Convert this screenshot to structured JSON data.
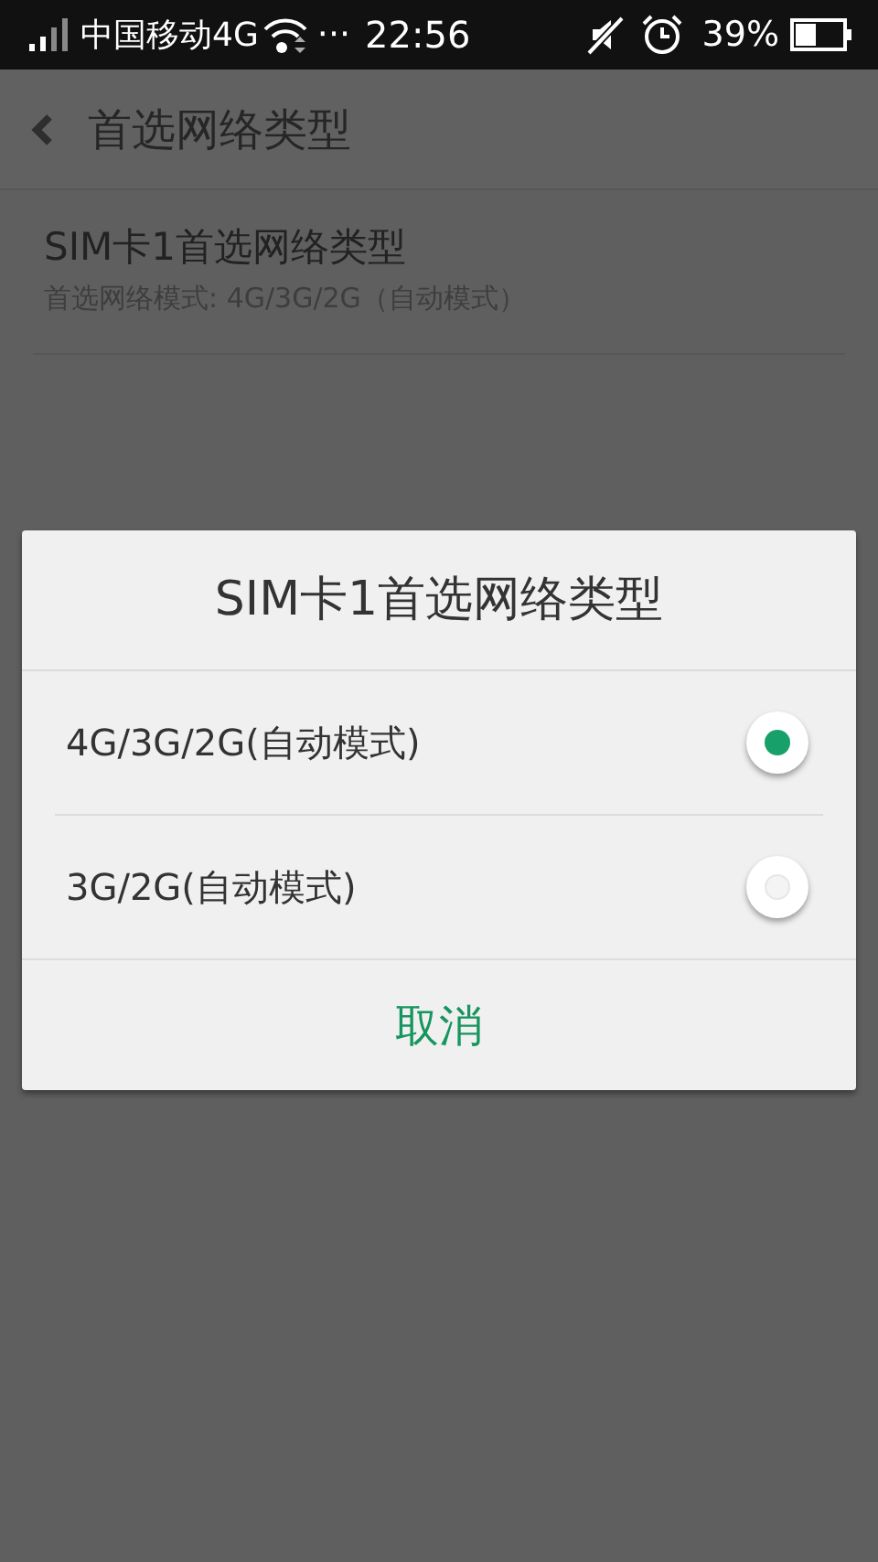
{
  "status_bar": {
    "carrier": "中国移动4G",
    "more": "···",
    "time": "22:56",
    "battery": "39%"
  },
  "header": {
    "title": "首选网络类型"
  },
  "settings": [
    {
      "title": "SIM卡1首选网络类型",
      "subtitle": "首选网络模式: 4G/3G/2G（自动模式）"
    }
  ],
  "dialog": {
    "title": "SIM卡1首选网络类型",
    "options": [
      {
        "label": "4G/3G/2G(自动模式)",
        "selected": true
      },
      {
        "label": "3G/2G(自动模式)",
        "selected": false
      }
    ],
    "cancel": "取消"
  }
}
